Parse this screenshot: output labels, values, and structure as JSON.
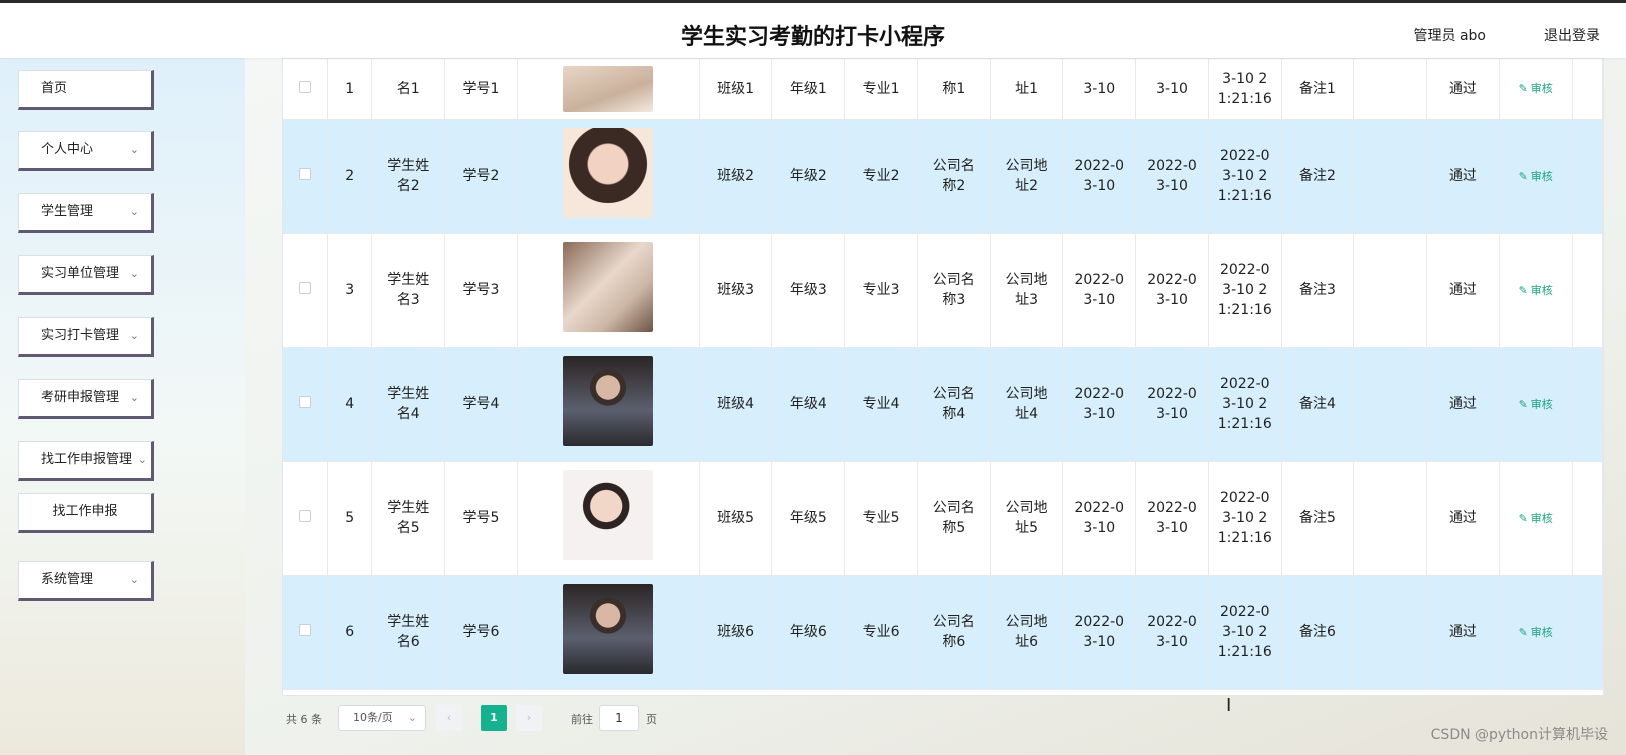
{
  "header": {
    "title": "学生实习考勤的打卡小程序",
    "admin": "管理员 abo",
    "logout": "退出登录"
  },
  "sidebar": {
    "items": [
      {
        "label": "首页"
      },
      {
        "label": "个人中心"
      },
      {
        "label": "学生管理"
      },
      {
        "label": "实习单位管理"
      },
      {
        "label": "实习打卡管理"
      },
      {
        "label": "考研申报管理"
      },
      {
        "label": "找工作申报管理"
      },
      {
        "label": "找工作申报"
      },
      {
        "label": "系统管理"
      }
    ]
  },
  "table": {
    "audit_label": "审核",
    "rows": [
      {
        "index": "1",
        "name": "名1",
        "student_no": "学号1",
        "class": "班级1",
        "grade": "年级1",
        "major": "专业1",
        "company": "称1",
        "address": "址1",
        "date1": "3-10",
        "date2": "3-10",
        "time": "3-10 2\n1:21:16",
        "remark": "备注1",
        "status": "通过"
      },
      {
        "index": "2",
        "name": "学生姓\n名2",
        "student_no": "学号2",
        "class": "班级2",
        "grade": "年级2",
        "major": "专业2",
        "company": "公司名\n称2",
        "address": "公司地\n址2",
        "date1": "2022-0\n3-10",
        "date2": "2022-0\n3-10",
        "time": "2022-0\n3-10 2\n1:21:16",
        "remark": "备注2",
        "status": "通过"
      },
      {
        "index": "3",
        "name": "学生姓\n名3",
        "student_no": "学号3",
        "class": "班级3",
        "grade": "年级3",
        "major": "专业3",
        "company": "公司名\n称3",
        "address": "公司地\n址3",
        "date1": "2022-0\n3-10",
        "date2": "2022-0\n3-10",
        "time": "2022-0\n3-10 2\n1:21:16",
        "remark": "备注3",
        "status": "通过"
      },
      {
        "index": "4",
        "name": "学生姓\n名4",
        "student_no": "学号4",
        "class": "班级4",
        "grade": "年级4",
        "major": "专业4",
        "company": "公司名\n称4",
        "address": "公司地\n址4",
        "date1": "2022-0\n3-10",
        "date2": "2022-0\n3-10",
        "time": "2022-0\n3-10 2\n1:21:16",
        "remark": "备注4",
        "status": "通过"
      },
      {
        "index": "5",
        "name": "学生姓\n名5",
        "student_no": "学号5",
        "class": "班级5",
        "grade": "年级5",
        "major": "专业5",
        "company": "公司名\n称5",
        "address": "公司地\n址5",
        "date1": "2022-0\n3-10",
        "date2": "2022-0\n3-10",
        "time": "2022-0\n3-10 2\n1:21:16",
        "remark": "备注5",
        "status": "通过"
      },
      {
        "index": "6",
        "name": "学生姓\n名6",
        "student_no": "学号6",
        "class": "班级6",
        "grade": "年级6",
        "major": "专业6",
        "company": "公司名\n称6",
        "address": "公司地\n址6",
        "date1": "2022-0\n3-10",
        "date2": "2022-0\n3-10",
        "time": "2022-0\n3-10 2\n1:21:16",
        "remark": "备注6",
        "status": "通过"
      }
    ]
  },
  "pagination": {
    "total": "共 6 条",
    "page_size": "10条/页",
    "current_page": "1",
    "goto_label": "前往",
    "goto_value": "1",
    "page_unit": "页"
  },
  "watermark": "CSDN @python计算机毕设",
  "colors": {
    "accent": "#16b28f",
    "row_highlight": "#d7effc",
    "menu_border": "#5f5a72"
  }
}
